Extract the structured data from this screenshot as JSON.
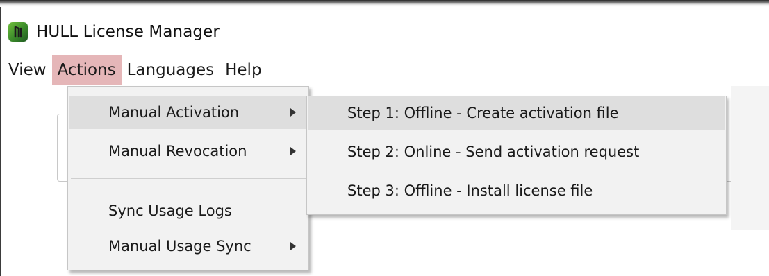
{
  "window": {
    "title": "HULL License Manager",
    "app_icon": "hull-logo-icon",
    "accent_color": "#4a9a2e"
  },
  "menubar": {
    "items": [
      {
        "label": "View"
      },
      {
        "label": "Actions",
        "active": true
      },
      {
        "label": "Languages"
      },
      {
        "label": "Help"
      }
    ],
    "active_color": "#e5b6b8"
  },
  "actions_menu": {
    "items": [
      {
        "label": "Manual Activation",
        "has_submenu": true,
        "highlighted": true
      },
      {
        "label": "Manual Revocation",
        "has_submenu": true
      },
      {
        "label": "Sync Usage Logs",
        "has_submenu": false
      },
      {
        "label": "Manual Usage Sync",
        "has_submenu": true
      }
    ]
  },
  "activation_submenu": {
    "items": [
      {
        "label": "Step 1: Offline - Create activation file",
        "highlighted": true
      },
      {
        "label": "Step 2: Online - Send activation request"
      },
      {
        "label": "Step 3: Offline - Install license file"
      }
    ]
  }
}
